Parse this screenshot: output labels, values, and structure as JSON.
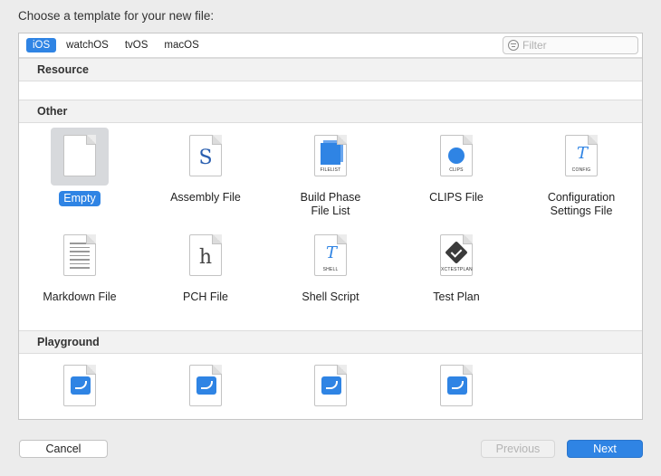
{
  "dialog": {
    "prompt": "Choose a template for your new file:"
  },
  "platform_tabs": [
    {
      "label": "iOS",
      "selected": true
    },
    {
      "label": "watchOS",
      "selected": false
    },
    {
      "label": "tvOS",
      "selected": false
    },
    {
      "label": "macOS",
      "selected": false
    }
  ],
  "filter": {
    "placeholder": "Filter",
    "value": ""
  },
  "sections": {
    "resource": {
      "title": "Resource"
    },
    "other": {
      "title": "Other",
      "items": [
        {
          "label": "Empty",
          "icon": "empty-file-icon",
          "selected": true
        },
        {
          "label": "Assembly File",
          "icon": "assembly-file-icon",
          "glyph": "S"
        },
        {
          "label": "Build Phase\nFile List",
          "icon": "filelist-icon",
          "caption": "FILELIST"
        },
        {
          "label": "CLIPS File",
          "icon": "clips-file-icon",
          "caption": "CLIPS"
        },
        {
          "label": "Configuration\nSettings File",
          "icon": "config-file-icon",
          "caption": "CONFIG"
        },
        {
          "label": "Markdown File",
          "icon": "markdown-file-icon"
        },
        {
          "label": "PCH File",
          "icon": "pch-file-icon",
          "glyph": "h"
        },
        {
          "label": "Shell Script",
          "icon": "shell-script-icon",
          "caption": "SHELL"
        },
        {
          "label": "Test Plan",
          "icon": "test-plan-icon",
          "caption": "XCTESTPLAN"
        }
      ]
    },
    "playground": {
      "title": "Playground",
      "items": [
        {
          "icon": "swift-playground-icon"
        },
        {
          "icon": "swift-playground-icon"
        },
        {
          "icon": "swift-playground-icon"
        },
        {
          "icon": "swift-playground-icon"
        }
      ]
    }
  },
  "buttons": {
    "cancel": "Cancel",
    "previous": "Previous",
    "next": "Next"
  },
  "colors": {
    "accent": "#2f84e4",
    "background": "#ececec"
  }
}
